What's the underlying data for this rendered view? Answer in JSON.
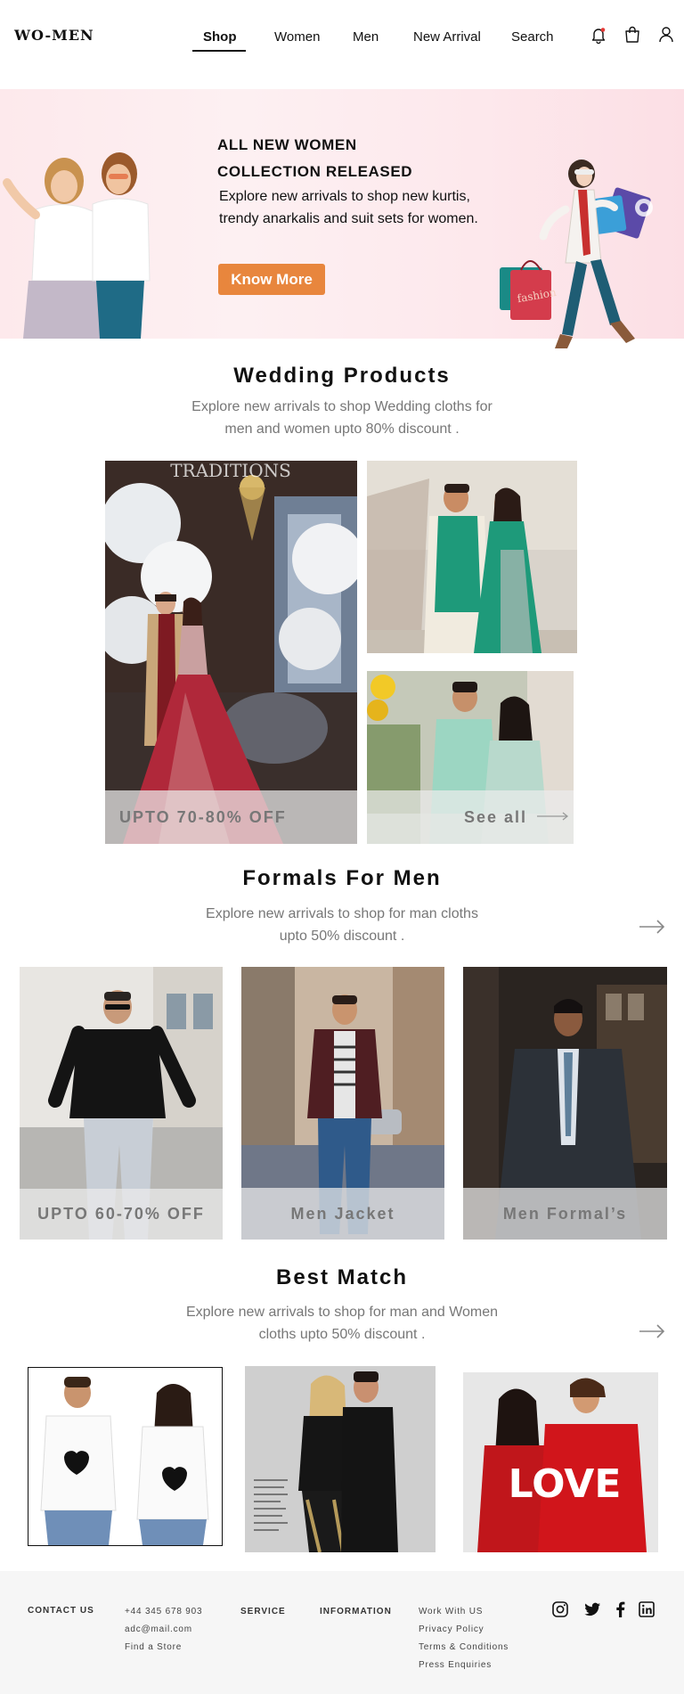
{
  "header": {
    "logo": "WO-MEN",
    "nav": [
      "Shop",
      "Women",
      "Men",
      "New Arrival",
      "Search"
    ],
    "active_nav": "Shop",
    "icons": [
      "bell-icon",
      "shopping-bag-icon",
      "user-icon"
    ],
    "notification_color": "#e53935"
  },
  "hero": {
    "title_line1": "ALL NEW WOMEN",
    "title_line2": "COLLECTION RELEASED",
    "description": "Explore new arrivals to shop new kurtis, trendy anarkalis and suit sets for women.",
    "button": "Know More",
    "button_color": "#e8863d",
    "bag_label": "fashion"
  },
  "wedding": {
    "title": "Wedding Products",
    "description": "Explore new arrivals to shop Wedding cloths for men and women upto 80% discount .",
    "watermark": "TRADITIONS",
    "offer": "UPTO 70-80% OFF",
    "see_all": "See all"
  },
  "formals": {
    "title": "Formals For Men",
    "description": "Explore new arrivals to shop for man cloths upto 50% discount .",
    "tiles": [
      "UPTO 60-70% OFF",
      "Men Jacket",
      "Men Formal’s"
    ]
  },
  "best_match": {
    "title": "Best Match",
    "description": "Explore new arrivals to shop for man and Women cloths upto 50% discount .",
    "tee_text": "LOVE"
  },
  "footer": {
    "contact_heading": "CONTACT US",
    "phone": "+44 345 678 903",
    "email": "adc@mail.com",
    "store": "Find a Store",
    "service_heading": "SERVICE",
    "information_heading": "INFORMATION",
    "links": [
      "Work With US",
      "Privacy Policy",
      "Terms & Conditions",
      "Press Enquiries"
    ],
    "social": [
      "instagram-icon",
      "twitter-icon",
      "facebook-icon",
      "linkedin-icon"
    ]
  }
}
